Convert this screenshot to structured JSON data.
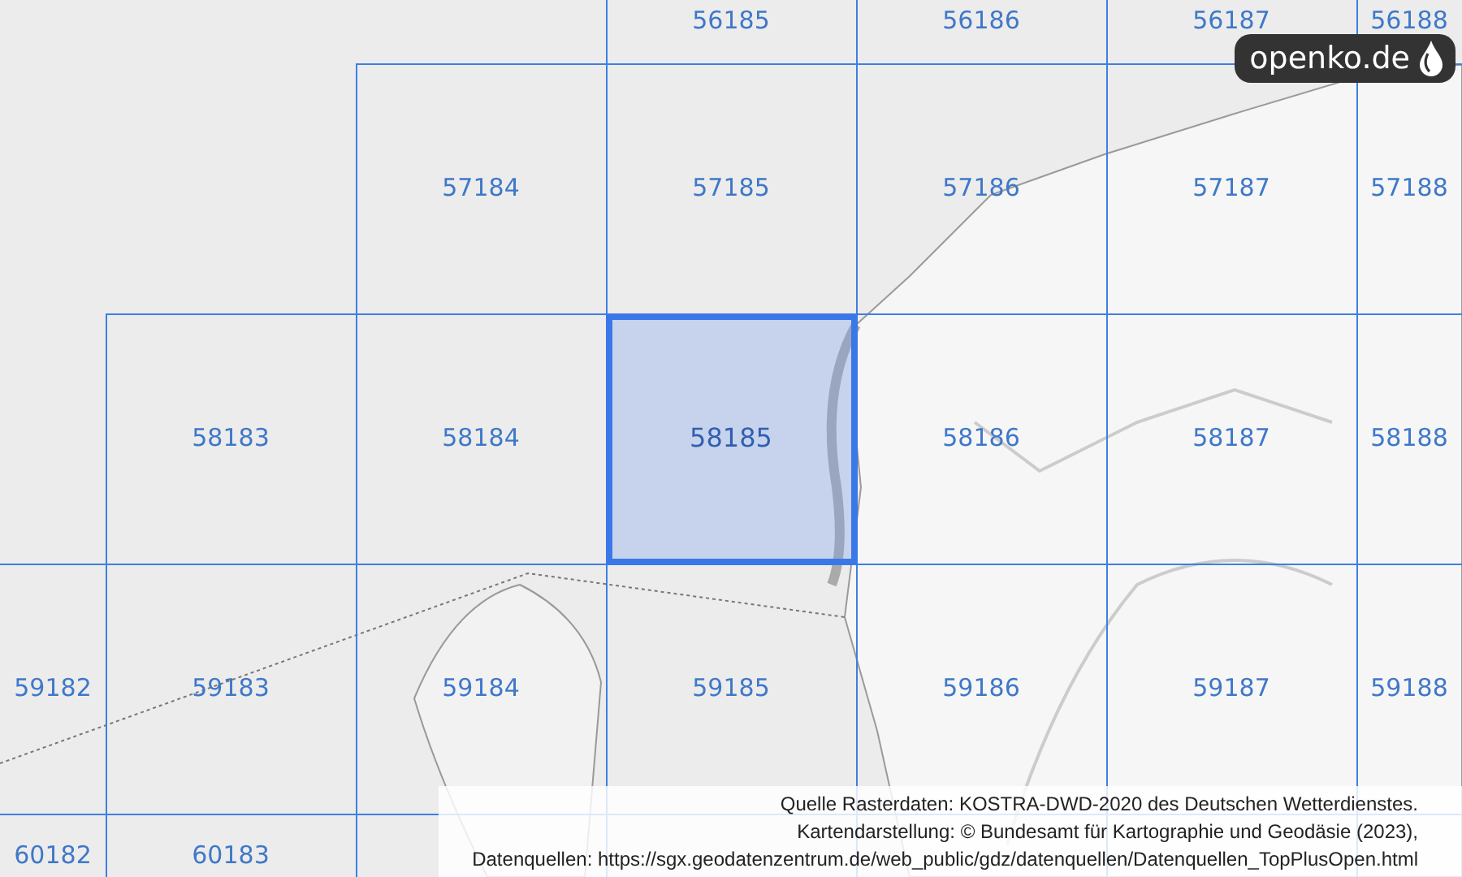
{
  "logo": {
    "text": "openko.de"
  },
  "grid": {
    "rows": [
      {
        "cells": [
          null,
          null,
          null,
          {
            "label": "56185",
            "selected": false
          },
          {
            "label": "56186",
            "selected": false
          },
          {
            "label": "56187",
            "selected": false
          },
          {
            "label": "56188",
            "selected": false
          }
        ]
      },
      {
        "cells": [
          null,
          null,
          {
            "label": "57184",
            "selected": false
          },
          {
            "label": "57185",
            "selected": false
          },
          {
            "label": "57186",
            "selected": false
          },
          {
            "label": "57187",
            "selected": false
          },
          {
            "label": "57188",
            "selected": false
          }
        ]
      },
      {
        "cells": [
          null,
          {
            "label": "58183",
            "selected": false
          },
          {
            "label": "58184",
            "selected": false
          },
          {
            "label": "58185",
            "selected": true
          },
          {
            "label": "58186",
            "selected": false
          },
          {
            "label": "58187",
            "selected": false
          },
          {
            "label": "58188",
            "selected": false
          }
        ]
      },
      {
        "cells": [
          {
            "label": "59182",
            "selected": false
          },
          {
            "label": "59183",
            "selected": false
          },
          {
            "label": "59184",
            "selected": false
          },
          {
            "label": "59185",
            "selected": false
          },
          {
            "label": "59186",
            "selected": false
          },
          {
            "label": "59187",
            "selected": false
          },
          {
            "label": "59188",
            "selected": false
          }
        ]
      },
      {
        "cells": [
          {
            "label": "60182",
            "selected": false
          },
          {
            "label": "60183",
            "selected": false
          }
        ]
      }
    ]
  },
  "attribution": {
    "lines": [
      "Quelle Rasterdaten: KOSTRA-DWD-2020 des Deutschen Wetterdienstes.",
      "Kartendarstellung: © Bundesamt für Kartographie und Geodäsie (2023),",
      "Datenquellen: https://sgx.geodatenzentrum.de/web_public/gdz/datenquellen/Datenquellen_TopPlusOpen.html"
    ]
  }
}
